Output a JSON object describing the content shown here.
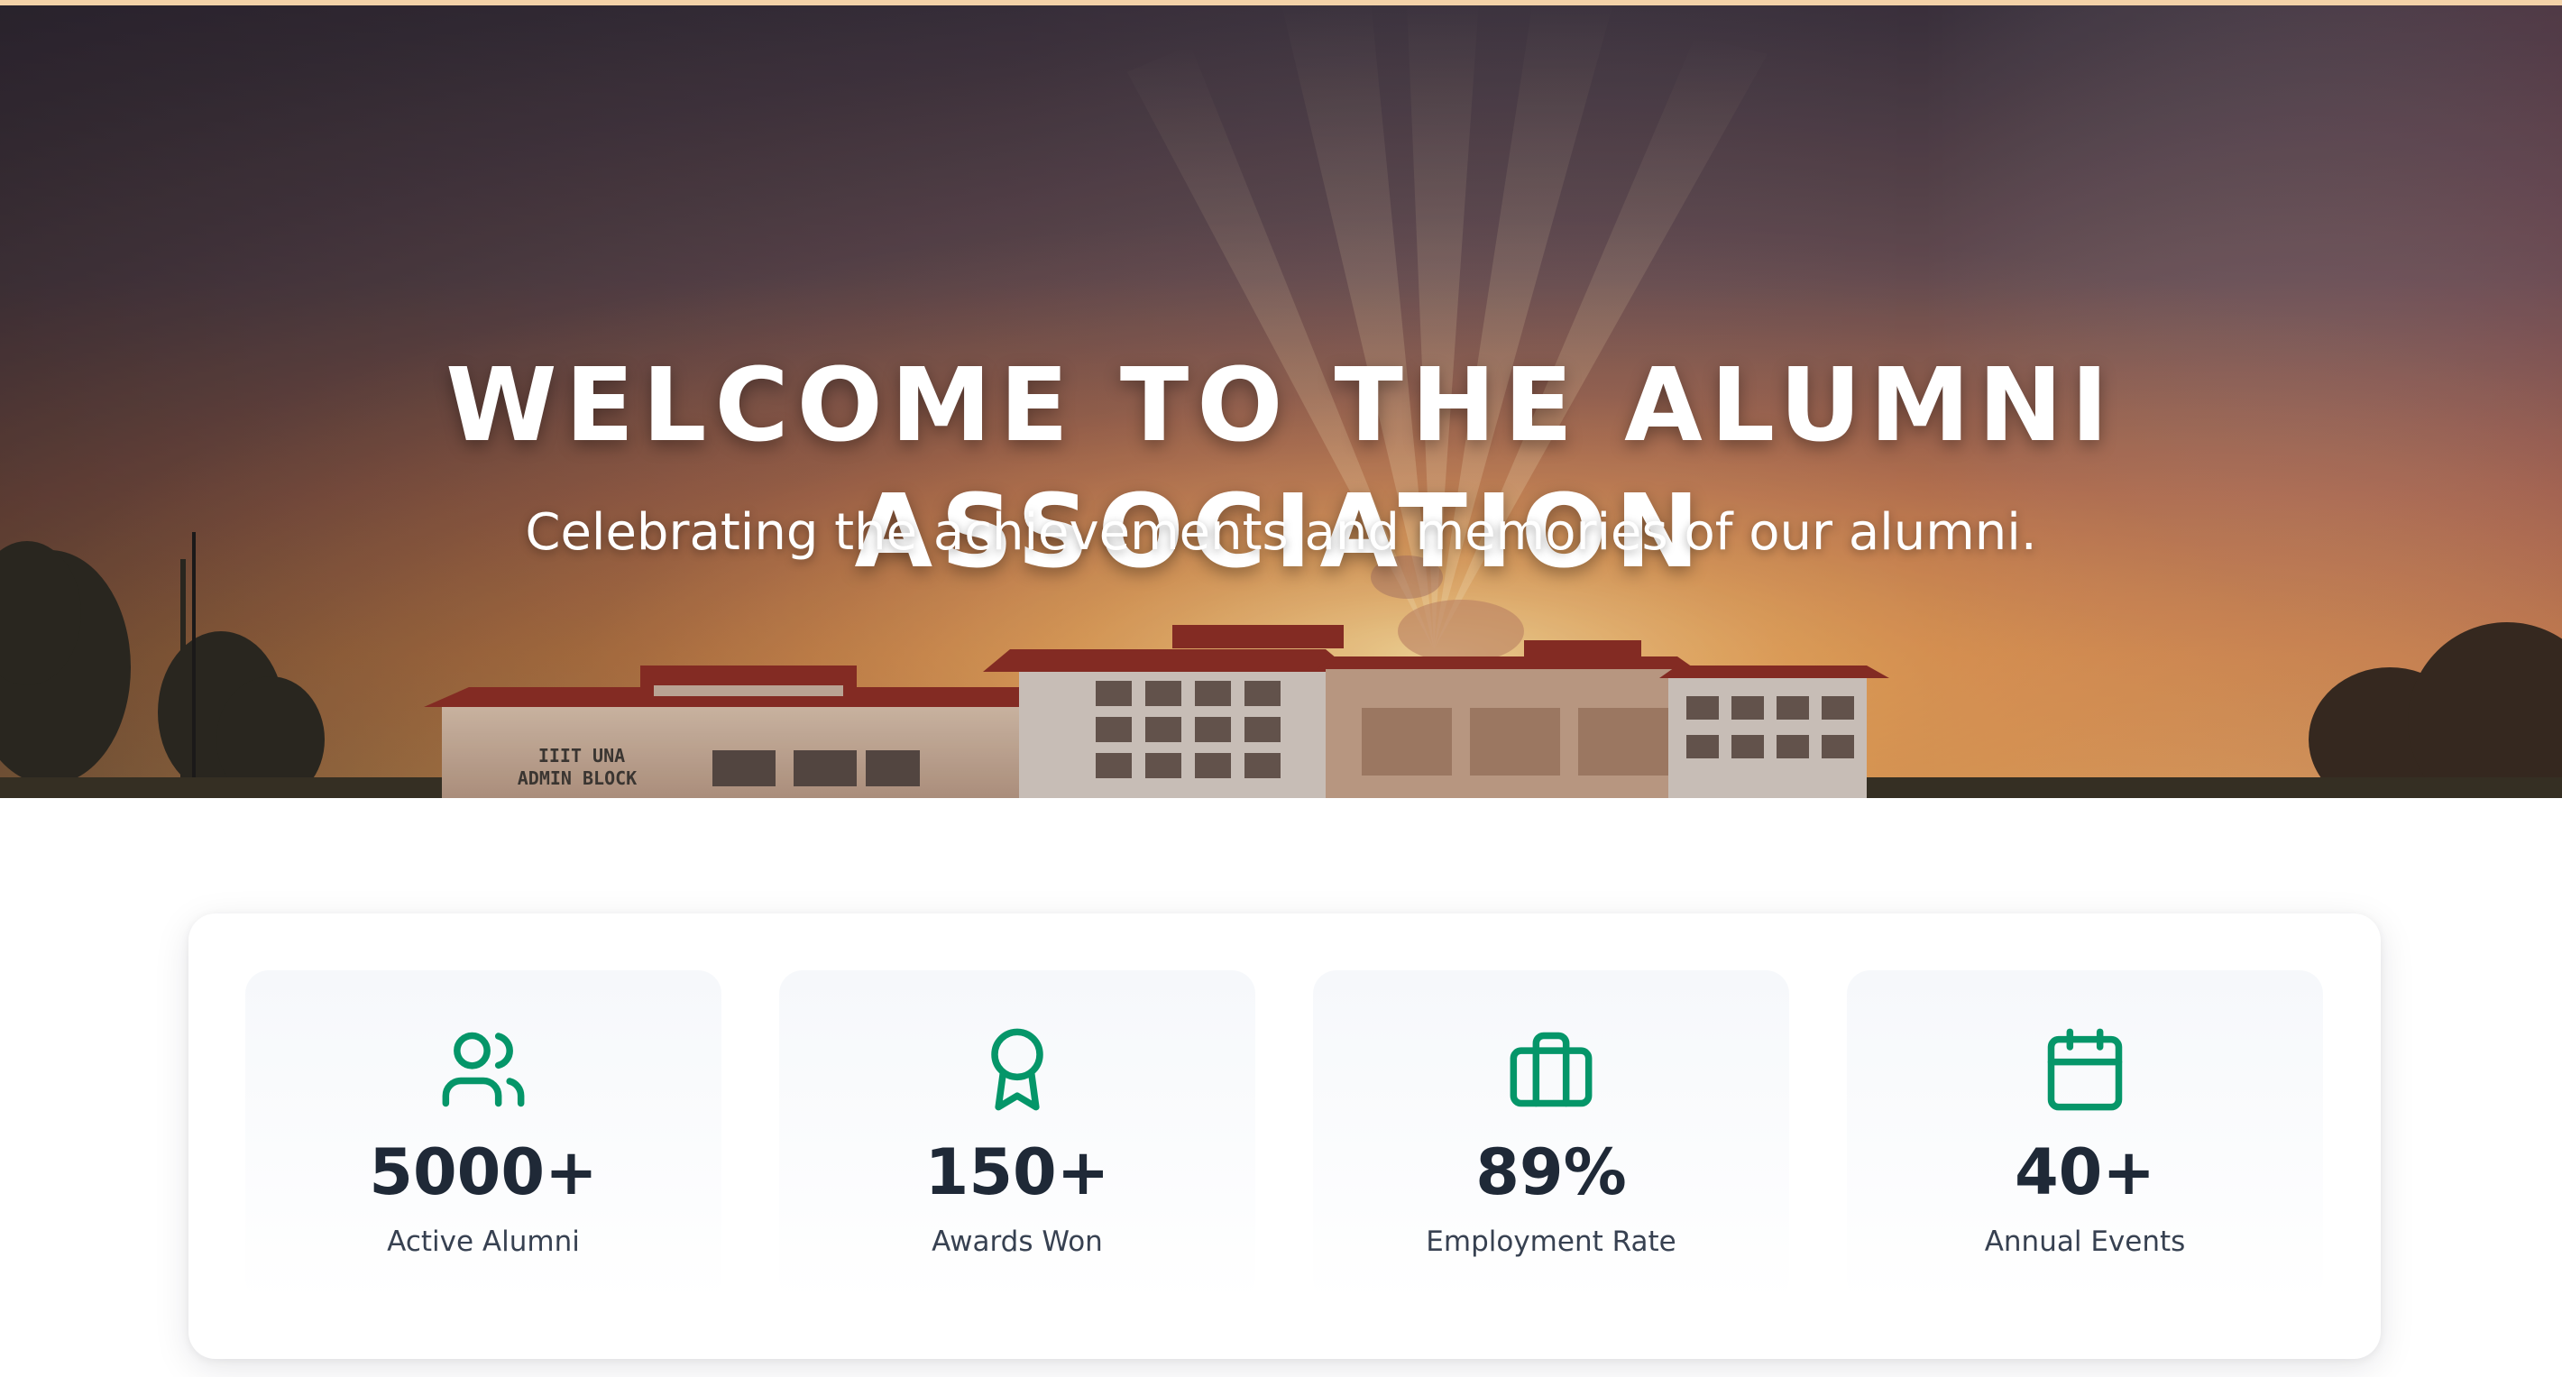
{
  "hero": {
    "title": "WELCOME TO THE ALUMNI ASSOCIATION",
    "subtitle": "Celebrating the achievements and memories of our alumni.",
    "building_sign_line1": "IIIT UNA",
    "building_sign_line2": "ADMIN BLOCK"
  },
  "stats": [
    {
      "value": "5000+",
      "label": "Active Alumni",
      "icon": "users-icon"
    },
    {
      "value": "150+",
      "label": "Awards Won",
      "icon": "award-icon"
    },
    {
      "value": "89%",
      "label": "Employment Rate",
      "icon": "briefcase-icon"
    },
    {
      "value": "40+",
      "label": "Annual Events",
      "icon": "calendar-icon"
    }
  ],
  "colors": {
    "accent": "#059669",
    "value_text": "#1f2937",
    "label_text": "#374151",
    "card_bg": "#ffffff"
  }
}
